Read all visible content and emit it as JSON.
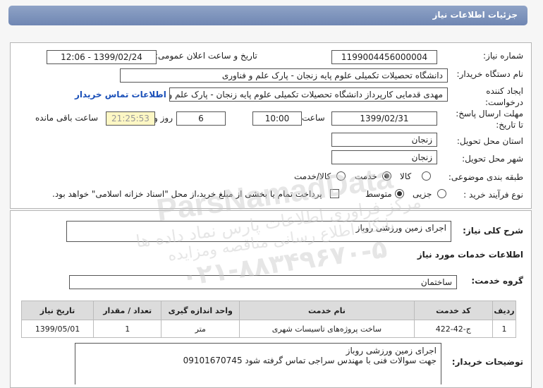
{
  "header": {
    "title": "جزئیات اطلاعات نیاز"
  },
  "need": {
    "number_label": "شماره نیاز:",
    "number": "1199004456000004",
    "announce_label": "تاریخ و ساعت اعلان عمومی:",
    "announce": "1399/02/24 - 12:06",
    "buyer_label": "نام دستگاه خریدار:",
    "buyer": "دانشگاه تحصیلات تکمیلی علوم پایه زنجان - پارک علم و فناوری",
    "creator_label_1": "ایجاد کننده",
    "creator_label_2": "درخواست:",
    "creator": "مهدی قدمایی کارپرداز دانشگاه تحصیلات تکمیلی علوم پایه زنجان - پارک علم و فناوری",
    "contact_link": "اطلاعات تماس خریدار",
    "deadline_label_1": "مهلت ارسال پاسخ:",
    "deadline_label_2": "تا تاریخ:",
    "deadline_date": "1399/02/31",
    "time_label": "ساعت",
    "deadline_time": "10:00",
    "days_value": "6",
    "days_label": "روز و",
    "remaining_time": "21:25:53",
    "remaining_label": "ساعت باقی مانده",
    "province_label": "استان محل تحویل:",
    "province": "زنجان",
    "city_label": "شهر محل تحویل:",
    "city": "زنجان",
    "category_label": "طبقه بندی موضوعی:",
    "category_options": [
      "کالا",
      "خدمت",
      "کالا/خدمت"
    ],
    "category_selected": "خدمت",
    "process_label": "نوع فرآیند خرید :",
    "process_options": [
      "جزیی",
      "متوسط"
    ],
    "process_selected": "متوسط",
    "payment_note": "پرداخت تمام یا بخشی از مبلغ خرید،از محل \"اسناد خزانه اسلامی\" خواهد بود."
  },
  "description": {
    "label": "شرح کلی نیاز:",
    "value": "اجرای زمین ورزشی روباز"
  },
  "services": {
    "section_title": "اطلاعات خدمات مورد نیاز",
    "group_label": "گروه خدمت:",
    "group_value": "ساختمان",
    "columns": [
      "ردیف",
      "کد خدمت",
      "نام خدمت",
      "واحد اندازه گیری",
      "تعداد / مقدار",
      "تاریخ نیاز"
    ],
    "rows": [
      [
        "1",
        "ج-42-422",
        "ساخت پروژه‌های تاسیسات شهری",
        "متر",
        "1",
        "1399/05/01"
      ]
    ]
  },
  "buyer_notes": {
    "label": "توضیحات خریدار:",
    "line1": "اجرای زمین ورزشی روباز",
    "line2": "جهت سوالات فنی با مهندس سراجی تماس گرفته شود 09101670745"
  },
  "watermark": {
    "line1": "ParsNamadData",
    "line2": "مرکز فراوری اطلاعات پارس نماد داده ها",
    "line3": "پایگاه اطلاع رسانی مناقصه ومزایده",
    "line4": "۰۲۱-۸۸۳۴۹۶۷۰-۵",
    "colors": {
      "watermark": "#c8c8c8"
    }
  }
}
